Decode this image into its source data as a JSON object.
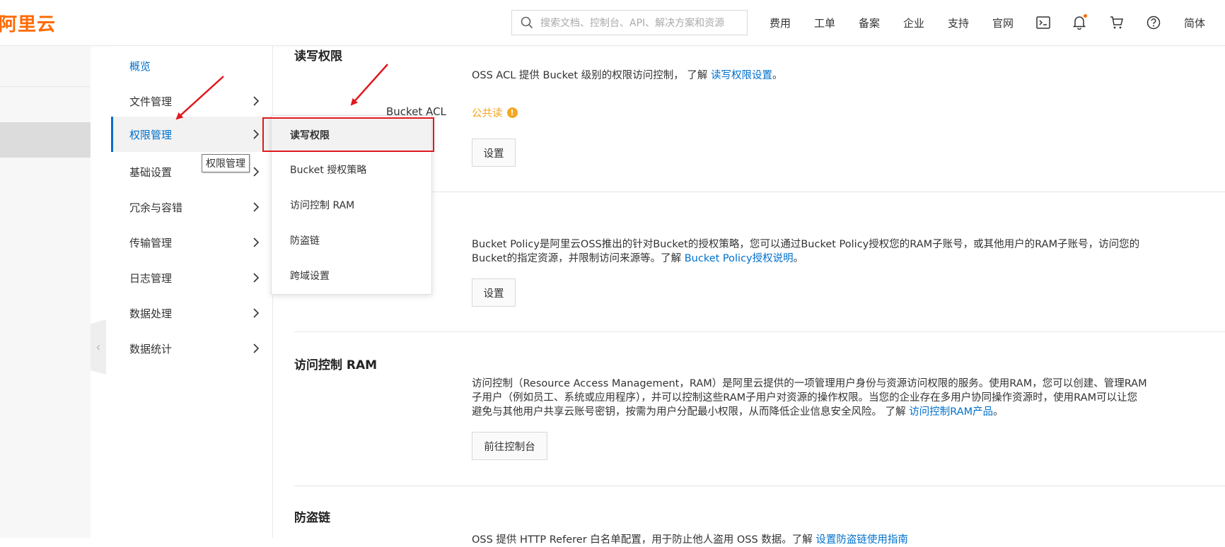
{
  "header": {
    "logo": "阿里云",
    "search_placeholder": "搜索文档、控制台、API、解决方案和资源",
    "nav": [
      "费用",
      "工单",
      "备案",
      "企业",
      "支持",
      "官网"
    ],
    "lang": "简体",
    "icons": [
      "terminal-icon",
      "bell-icon",
      "cart-icon",
      "help-icon"
    ],
    "accent_color": "#ff6a00"
  },
  "sidebar": {
    "items": [
      {
        "label": "概览"
      },
      {
        "label": "文件管理"
      },
      {
        "label": "权限管理"
      },
      {
        "label": "基础设置"
      },
      {
        "label": "冗余与容错"
      },
      {
        "label": "传输管理"
      },
      {
        "label": "日志管理"
      },
      {
        "label": "数据处理"
      },
      {
        "label": "数据统计"
      }
    ],
    "tooltip": "权限管理"
  },
  "flyout": {
    "items": [
      "读写权限",
      "Bucket 授权策略",
      "访问控制 RAM",
      "防盗链",
      "跨域设置"
    ]
  },
  "main": {
    "acl": {
      "title": "读写权限",
      "desc": "OSS ACL 提供 Bucket 级别的权限访问控制， 了解 ",
      "link": "读写权限设置",
      "tail": "。",
      "label": "Bucket ACL",
      "value": "公共读",
      "button": "设置"
    },
    "policy": {
      "desc_line1": "Bucket Policy是阿里云OSS推出的针对Bucket的授权策略，您可以通过Bucket Policy授权您的RAM子账号，或其他用户的RAM子账号，访问您的",
      "desc_line2": "Bucket的指定资源，并限制访问来源等。了解 ",
      "link": "Bucket Policy授权说明",
      "tail": "。",
      "button": "设置"
    },
    "ram": {
      "title": "访问控制 RAM",
      "desc_line1": "访问控制（Resource Access Management，RAM）是阿里云提供的一项管理用户身份与资源访问权限的服务。使用RAM，您可以创建、管理RAM",
      "desc_line2": "子用户（例如员工、系统或应用程序），并可以控制这些RAM子用户对资源的操作权限。当您的企业存在多用户协同操作资源时，使用RAM可以让您",
      "desc_line3": "避免与其他用户共享云账号密钥，按需为用户分配最小权限，从而降低企业信息安全风险。 了解 ",
      "link": "访问控制RAM产品",
      "tail": "。",
      "button": "前往控制台"
    },
    "referer": {
      "title": "防盗链",
      "desc": "OSS 提供 HTTP Referer 白名单配置，用于防止他人盗用 OSS 数据。了解 ",
      "link": "设置防盗链使用指南"
    }
  }
}
